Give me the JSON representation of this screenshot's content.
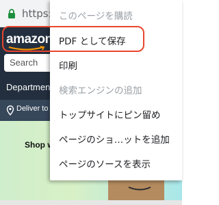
{
  "browser": {
    "url": "https://w"
  },
  "amazon": {
    "logo_text": "amazon",
    "search_placeholder": "Search",
    "departments": "Departments",
    "deliver_to": "Deliver to J",
    "hero_text": "Shop wi"
  },
  "menu": {
    "items": [
      {
        "label": "このページを購読",
        "enabled": false
      },
      {
        "label": "PDF として保存",
        "enabled": true
      },
      {
        "label": "印刷",
        "enabled": true
      },
      {
        "label": "検索エンジンの追加",
        "enabled": false
      },
      {
        "label": "トップサイトにピン留め",
        "enabled": true
      },
      {
        "label": "ページのショ…ットを追加",
        "enabled": true
      },
      {
        "label": "ページのソースを表示",
        "enabled": true
      }
    ],
    "highlighted_item": "PDF として保存"
  },
  "colors": {
    "amazon_header": "#232f3e",
    "deliver_bar": "#37475a",
    "amazon_orange": "#ff9900",
    "highlight_red": "#e8452d",
    "lock_green": "#1e8e3e"
  }
}
